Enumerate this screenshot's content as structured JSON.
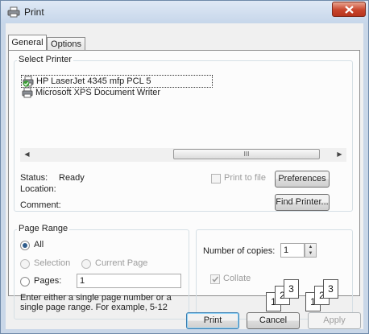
{
  "window": {
    "title": "Print"
  },
  "tabs": [
    {
      "label": "General",
      "active": true
    },
    {
      "label": "Options",
      "active": false
    }
  ],
  "select_printer": {
    "group_label": "Select Printer",
    "printers": [
      {
        "name": "HP LaserJet 4345 mfp PCL 5",
        "selected": true,
        "default": true
      },
      {
        "name": "Microsoft XPS Document Writer",
        "selected": false,
        "default": false
      }
    ],
    "scrollbar": {
      "thumb_glyph": "III"
    }
  },
  "status": {
    "status_label": "Status:",
    "status_value": "Ready",
    "location_label": "Location:",
    "location_value": "",
    "comment_label": "Comment:",
    "comment_value": ""
  },
  "print_to_file": {
    "label": "Print to file",
    "checked": false,
    "enabled": false
  },
  "buttons": {
    "preferences": "Preferences",
    "find_printer": "Find Printer...",
    "print": "Print",
    "cancel": "Cancel",
    "apply": "Apply"
  },
  "page_range": {
    "group_label": "Page Range",
    "all": "All",
    "selection": "Selection",
    "current_page": "Current Page",
    "pages": "Pages:",
    "pages_value": "1",
    "selected": "all",
    "hint": "Enter either a single page number or a single page range.  For example, 5-12"
  },
  "copies": {
    "label": "Number of copies:",
    "value": "1",
    "collate_label": "Collate",
    "collate_checked": true,
    "collate_enabled": false,
    "collate_pages": [
      "1",
      "2",
      "3"
    ]
  },
  "colors": {
    "title_bar": "#c6d6ea",
    "client": "#f0f0f0",
    "close": "#c8452c",
    "default_button_border": "#3c7fb1"
  }
}
